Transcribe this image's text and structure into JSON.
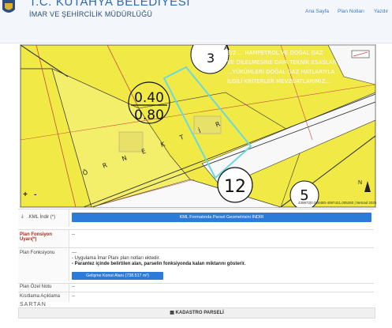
{
  "header": {
    "title": "T.C. KÜTAHYA BELEDİYESİ",
    "subtitle": "İMAR VE ŞEHİRCİLİK MÜDÜRLÜĞÜ"
  },
  "nav": {
    "home": "Ana Sayfa",
    "plan_notes": "Plan Notları",
    "print": "Yazdır"
  },
  "map": {
    "density_top": "0.40",
    "density_bottom": "0.80",
    "parcel_12": "12",
    "parcel_5": "5",
    "parcel_3": "3",
    "parcel_a": "A",
    "street_name": "Ö R N E K T İ R",
    "zoom_in": "+",
    "zoom_out": "-",
    "north": "N",
    "coordinates": "439972|0.029480-4087421,005260 | Netcad 2025",
    "overlay_text": [
      "3/2 ... HAMPETROL VE DOĞAL GAZ",
      "VE DİLELMESİNE DAİR TEKNİK ESASLAR",
      "...YÜKÜMLERİ DOĞAL GAZ HATLARIYLA",
      "İLGİLİ KRİTERLER MEVZUATLARIMIZ..."
    ]
  },
  "kml": {
    "label": ".KML İndir (*)",
    "button": "KML Formatında Parsel Geometrisini İNDİR"
  },
  "rows": {
    "plan_fonksiyon_uyari_label": "Plan Fonsiyon Uyarı(*)",
    "plan_fonksiyon_uyari_value": "--",
    "plan_fonksiyonu_label": "Plan Fonksiyonu",
    "plan_fonksiyonu_line1": "---",
    "plan_fonksiyonu_line2": "- Uygulama İmar Planı plan notları ektedir.",
    "plan_fonksiyonu_line3": "- Parantez içinde belirtilen alan, parselin fonksiyonda kalan miktarını gösterir.",
    "plan_fonksiyonu_btn": "Gelişme Konut Alanı (738.517 m²)",
    "plan_ozel_notu_label": "Plan Özel Notu",
    "plan_ozel_notu_value": "--",
    "kisitlama_label": "Kısıtlama Açıklama",
    "kisitlama_value": "--",
    "kadastro": "KADASTRO PARSELİ"
  },
  "watermark": "SARTAN",
  "colors": {
    "parcel_yellow": "#f1ea46",
    "highlight": "#6ad8e0",
    "button_blue": "#2c7bd8",
    "header_blue": "#2f69b2"
  }
}
